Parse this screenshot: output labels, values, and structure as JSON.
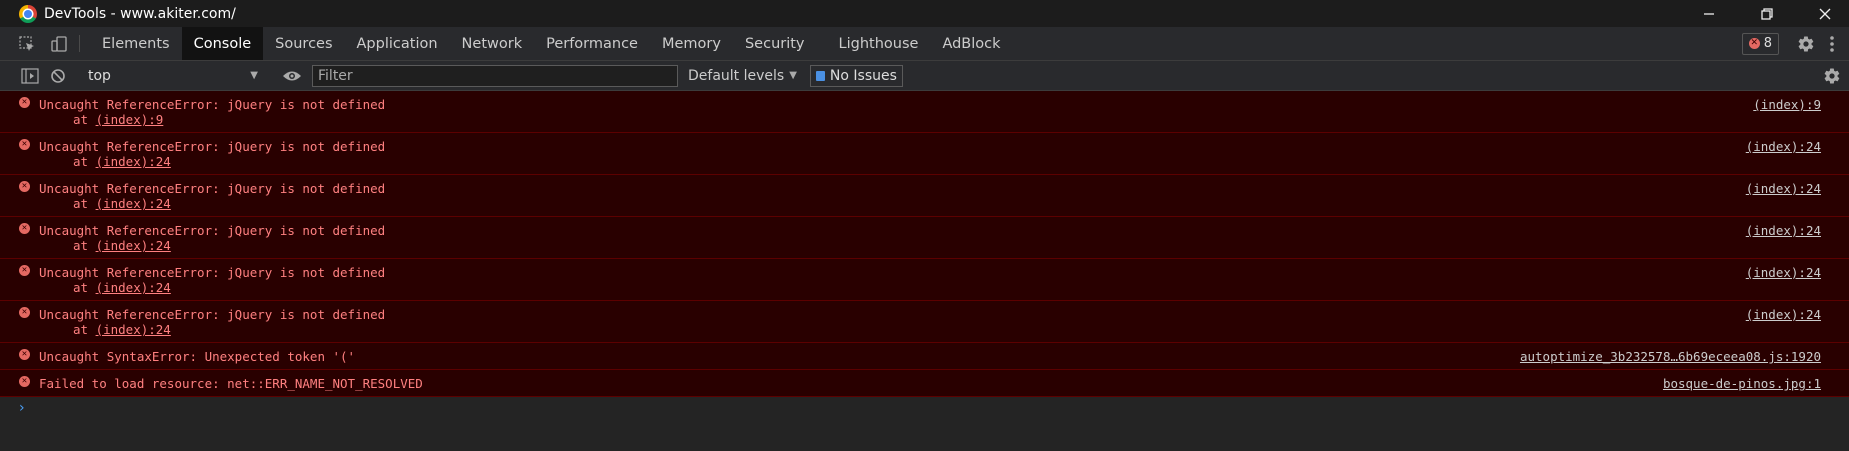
{
  "window": {
    "title": "DevTools - www.akiter.com/",
    "controls": [
      "minimize",
      "maximize",
      "close"
    ]
  },
  "tabs": [
    {
      "label": "Elements",
      "active": false
    },
    {
      "label": "Console",
      "active": true
    },
    {
      "label": "Sources",
      "active": false
    },
    {
      "label": "Application",
      "active": false
    },
    {
      "label": "Network",
      "active": false
    },
    {
      "label": "Performance",
      "active": false
    },
    {
      "label": "Memory",
      "active": false
    },
    {
      "label": "Security",
      "active": false
    },
    {
      "label": "Lighthouse",
      "active": false
    },
    {
      "label": "AdBlock",
      "active": false
    }
  ],
  "error_count": "8",
  "toolbar": {
    "context": "top",
    "filter_placeholder": "Filter",
    "levels": "Default levels",
    "issues": "No Issues"
  },
  "messages": [
    {
      "text": "Uncaught ReferenceError: jQuery is not defined",
      "at_prefix": "at ",
      "at_link": "(index):9",
      "source": "(index):9"
    },
    {
      "text": "Uncaught ReferenceError: jQuery is not defined",
      "at_prefix": "at ",
      "at_link": "(index):24",
      "source": "(index):24"
    },
    {
      "text": "Uncaught ReferenceError: jQuery is not defined",
      "at_prefix": "at ",
      "at_link": "(index):24",
      "source": "(index):24"
    },
    {
      "text": "Uncaught ReferenceError: jQuery is not defined",
      "at_prefix": "at ",
      "at_link": "(index):24",
      "source": "(index):24"
    },
    {
      "text": "Uncaught ReferenceError: jQuery is not defined",
      "at_prefix": "at ",
      "at_link": "(index):24",
      "source": "(index):24"
    },
    {
      "text": "Uncaught ReferenceError: jQuery is not defined",
      "at_prefix": "at ",
      "at_link": "(index):24",
      "source": "(index):24"
    },
    {
      "text": "Uncaught SyntaxError: Unexpected token '('",
      "source": "autoptimize_3b232578…6b69eceea08.js:1920"
    },
    {
      "text": "Failed to load resource: net::ERR_NAME_NOT_RESOLVED",
      "source": "bosque-de-pinos.jpg:1"
    }
  ],
  "prompt_symbol": "›",
  "colors": {
    "error_bg": "#290000",
    "error_text": "#ff8080",
    "active_tab": "#121212",
    "prompt": "#4a9ff5"
  }
}
